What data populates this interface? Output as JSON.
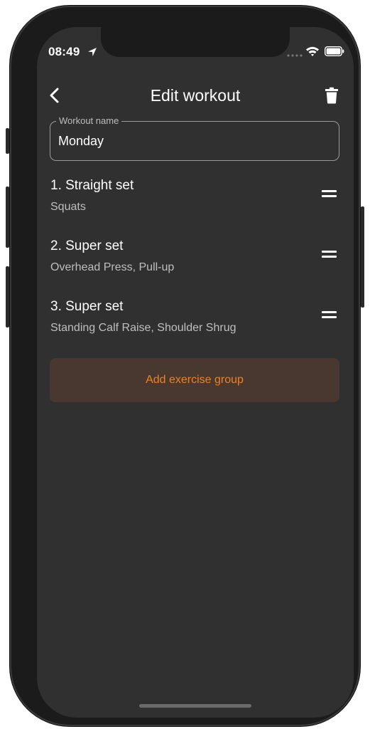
{
  "status_bar": {
    "time": "08:49",
    "icons": [
      "location-arrow-icon",
      "signal-dots-icon",
      "wifi-icon",
      "battery-icon"
    ]
  },
  "header": {
    "title": "Edit workout",
    "back_icon": "chevron-left-icon",
    "delete_icon": "trash-icon"
  },
  "workout_name": {
    "label": "Workout name",
    "value": "Monday"
  },
  "groups": [
    {
      "title": "1. Straight set",
      "exercises": "Squats"
    },
    {
      "title": "2. Super set",
      "exercises": "Overhead Press, Pull-up"
    },
    {
      "title": "3. Super set",
      "exercises": "Standing Calf Raise, Shoulder Shrug"
    }
  ],
  "add_button": {
    "label": "Add exercise group"
  },
  "colors": {
    "background": "#303030",
    "accent": "#f2811c",
    "button_background": "#483830",
    "secondary_text": "#bfbfbf"
  }
}
